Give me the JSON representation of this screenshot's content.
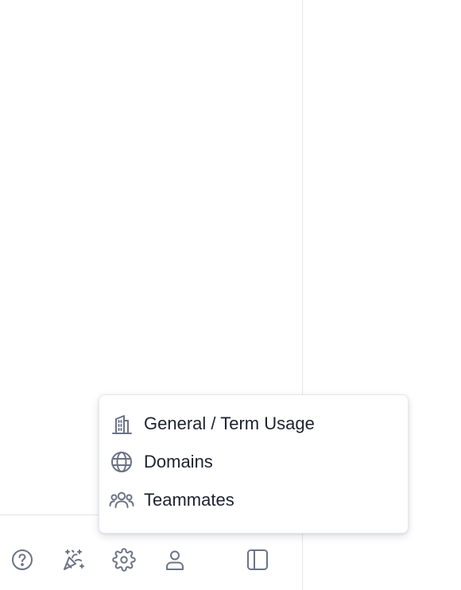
{
  "menu": {
    "items": [
      {
        "label": "General / Term Usage",
        "icon": "building-icon"
      },
      {
        "label": "Domains",
        "icon": "globe-icon"
      },
      {
        "label": "Teammates",
        "icon": "users-icon"
      }
    ]
  },
  "toolbar": {
    "buttons": [
      {
        "icon": "help-icon"
      },
      {
        "icon": "celebration-icon"
      },
      {
        "icon": "gear-icon"
      },
      {
        "icon": "user-icon"
      },
      {
        "icon": "sidebar-toggle-icon"
      }
    ]
  },
  "colors": {
    "icon": "#6b7385",
    "text": "#1e2230",
    "divider": "#e3e5ec"
  }
}
